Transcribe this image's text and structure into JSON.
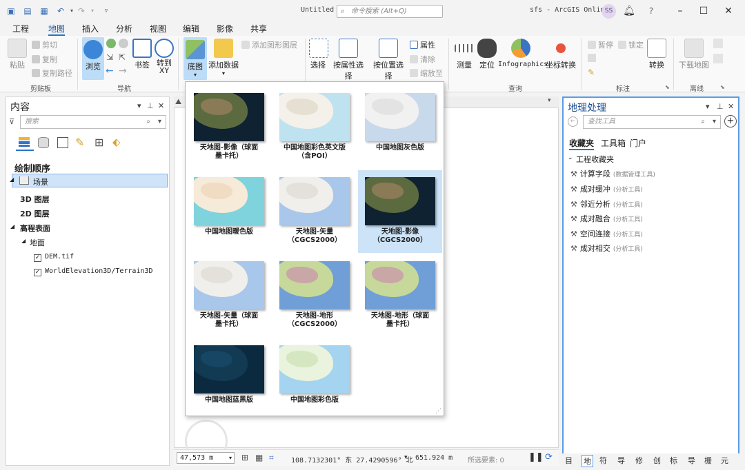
{
  "window": {
    "doc_title": "Untitled",
    "search_placeholder": "命令搜索 (Alt+Q)",
    "app_title": "sfs - ArcGIS Online",
    "avatar_initials": "SS",
    "help": "?"
  },
  "tabs": [
    "工程",
    "地图",
    "插入",
    "分析",
    "视图",
    "编辑",
    "影像",
    "共享"
  ],
  "ribbon": {
    "clipboard": {
      "paste": "粘贴",
      "cut": "剪切",
      "copy": "复制",
      "copy_path": "复制路径",
      "label": "剪贴板"
    },
    "navigate": {
      "explore": "浏览",
      "bookmarks": "书签",
      "goto_xy": "转到\nXY",
      "label": "导航"
    },
    "layer": {
      "basemap": "底图",
      "add_data": "添加数据",
      "add_graphics": "添加图形图层"
    },
    "selection": {
      "select": "选择",
      "by_attr": "按属性选择",
      "by_loc": "按位置选择",
      "attributes": "属性",
      "clear": "清除",
      "zoom_to": "缩放至"
    },
    "inquiry": {
      "measure": "测量",
      "locate": "定位",
      "infographics": "Infographics",
      "convert_coords": "坐标转换",
      "label": "查询"
    },
    "labeling": {
      "pause": "暂停",
      "lock": "锁定",
      "convert": "转换",
      "label": "标注"
    },
    "offline": {
      "download_map": "下载地图",
      "label": "离线"
    }
  },
  "contents": {
    "title": "内容",
    "search_placeholder": "搜索",
    "drawing_order": "绘制顺序",
    "scene": "场景",
    "layers_3d": "3D 图层",
    "layers_2d": "2D 图层",
    "elevation": "高程表面",
    "ground": "地面",
    "dem": "DEM.tif",
    "terrain": "WorldElevation3D/Terrain3D"
  },
  "gallery": [
    {
      "label": "天地图-影像（球面\n墨卡托）",
      "style": "imagery",
      "selected": false
    },
    {
      "label": "中国地图彩色英文版\n（含POI）",
      "style": "light",
      "selected": false
    },
    {
      "label": "中国地图灰色版",
      "style": "gray",
      "selected": false
    },
    {
      "label": "中国地图暖色版",
      "style": "warm",
      "selected": false
    },
    {
      "label": "天地图-矢量\n（CGCS2000）",
      "style": "vector",
      "selected": false
    },
    {
      "label": "天地图-影像\n（CGCS2000）",
      "style": "imagery",
      "selected": true
    },
    {
      "label": "天地图-矢量（球面\n墨卡托）",
      "style": "vector",
      "selected": false
    },
    {
      "label": "天地图-地形\n（CGCS2000）",
      "style": "terrain",
      "selected": false
    },
    {
      "label": "天地图-地形（球面\n墨卡托）",
      "style": "terrain",
      "selected": false
    },
    {
      "label": "中国地图蓝黑版",
      "style": "dark",
      "selected": false
    },
    {
      "label": "中国地图彩色版",
      "style": "color",
      "selected": false
    }
  ],
  "status": {
    "scale": "47,573 m",
    "coords": "108.7132301° 东  27.4290596° 北",
    "elevation": "651.924 m",
    "selected": "所选要素: 0"
  },
  "geoprocessing": {
    "title": "地理处理",
    "search_placeholder": "查找工具",
    "tabs": [
      "收藏夹",
      "工具箱",
      "门户"
    ],
    "section": "工程收藏夹",
    "tools": [
      {
        "name": "计算字段",
        "toolbox": "(数据管理工具)"
      },
      {
        "name": "成对缓冲",
        "toolbox": "(分析工具)"
      },
      {
        "name": "邻近分析",
        "toolbox": "(分析工具)"
      },
      {
        "name": "成对融合",
        "toolbox": "(分析工具)"
      },
      {
        "name": "空间连接",
        "toolbox": "(分析工具)"
      },
      {
        "name": "成对相交",
        "toolbox": "(分析工具)"
      }
    ]
  },
  "bottom_tabs": [
    "目",
    "地",
    "符",
    "导",
    "修",
    "创",
    "标",
    "导",
    "栅",
    "元"
  ]
}
